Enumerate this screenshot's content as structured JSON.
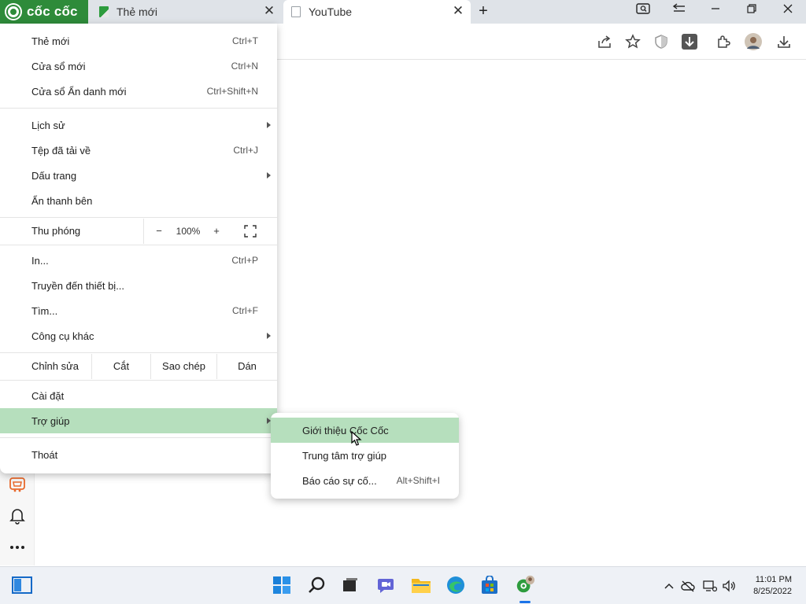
{
  "browser": {
    "brand": "cốc cốc",
    "tabs": [
      {
        "title": "Thẻ mới"
      },
      {
        "title": "YouTube"
      }
    ],
    "colors": {
      "brand_green": "#2e8b3a",
      "highlight": "#b6dfbd"
    }
  },
  "menu": {
    "items": {
      "new_tab": {
        "label": "Thẻ mới",
        "shortcut": "Ctrl+T"
      },
      "new_window": {
        "label": "Cửa sổ mới",
        "shortcut": "Ctrl+N"
      },
      "incognito": {
        "label": "Cửa sổ Ẩn danh mới",
        "shortcut": "Ctrl+Shift+N"
      },
      "history": {
        "label": "Lịch sử"
      },
      "downloads": {
        "label": "Tệp đã tải về",
        "shortcut": "Ctrl+J"
      },
      "bookmarks": {
        "label": "Dấu trang"
      },
      "hide_sidebar": {
        "label": "Ẩn thanh bên"
      },
      "print": {
        "label": "In...",
        "shortcut": "Ctrl+P"
      },
      "cast": {
        "label": "Truyền đến thiết bị..."
      },
      "find": {
        "label": "Tìm...",
        "shortcut": "Ctrl+F"
      },
      "more_tools": {
        "label": "Công cụ khác"
      },
      "settings": {
        "label": "Cài đặt"
      },
      "help": {
        "label": "Trợ giúp"
      },
      "exit": {
        "label": "Thoát"
      }
    },
    "zoom": {
      "label": "Thu phóng",
      "minus": "−",
      "value": "100%",
      "plus": "+"
    },
    "edit": {
      "label": "Chỉnh sửa",
      "cut": "Cắt",
      "copy": "Sao chép",
      "paste": "Dán"
    }
  },
  "submenu": {
    "about": {
      "label": "Giới thiệu Cốc Cốc"
    },
    "help_center": {
      "label": "Trung tâm trợ giúp"
    },
    "report": {
      "label": "Báo cáo sự cố...",
      "shortcut": "Alt+Shift+I"
    }
  },
  "taskbar": {
    "time": "11:01 PM",
    "date": "8/25/2022"
  }
}
